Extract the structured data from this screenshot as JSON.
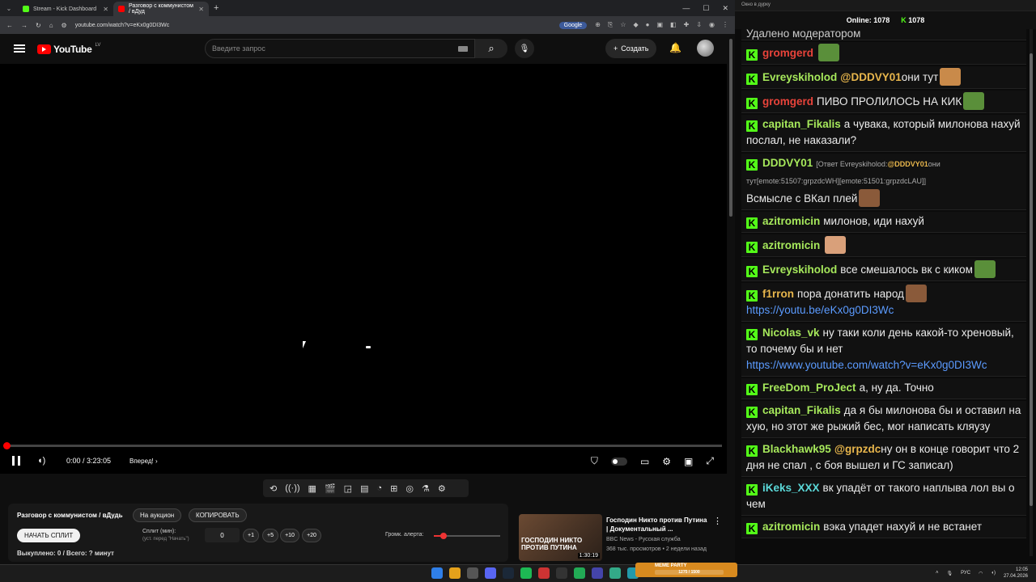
{
  "browser": {
    "tabs": [
      {
        "label": "Stream - Kick Dashboard",
        "color": "#53fc18"
      },
      {
        "label": "Разговор с коммунистом / вДуд",
        "color": "#ff0000"
      }
    ],
    "url": "youtube.com/watch?v=eKx0g0DI3Wc",
    "google_pill": "Google"
  },
  "youtube": {
    "logo": "YouTube",
    "region": "LV",
    "search_placeholder": "Введите запрос",
    "create_label": "Создать",
    "time": "0:00 / 3:23:05",
    "next_label": "Вперед!",
    "progress": 0
  },
  "panel": {
    "title": "Разговор с коммунистом / вДудь",
    "auction_btn": "На аукцион",
    "copy_btn": "КОПИРОВАТЬ",
    "start_btn": "НАЧАТЬ СПЛИТ",
    "split_label": "Сплит (мин):",
    "split_sub": "(уст. перед \"Начать\")",
    "split_value": "0",
    "increments": [
      "+1",
      "+5",
      "+10",
      "+20"
    ],
    "alert_label": "Громк. алерта:",
    "alert_volume": 0.15,
    "status": "Выкуплено: 0 / Всего: ? минут"
  },
  "recommended": {
    "thumb_text": "ГОСПОДИН НИКТО ПРОТИВ ПУТИНА",
    "duration": "1:30:19",
    "title": "Господин Никто против Путина | Документальный ...",
    "channel": "BBC News - Русская служба",
    "meta": "368 тыс. просмотров • 2 недели назад"
  },
  "chat_window": {
    "title": "Окно в дурку",
    "online_label": "Online:",
    "online_count": "1078",
    "kick_count": "1078"
  },
  "chat": [
    {
      "user": "gromgerd",
      "color": "#e8433a",
      "text": "",
      "emote": "#5a8f3a"
    },
    {
      "user": "Evreyskiholod",
      "color": "#a6e85b",
      "mention": "@DDDVY01",
      "text": "они тут",
      "emote": "#c98a4a"
    },
    {
      "user": "gromgerd",
      "color": "#e8433a",
      "text": "ПИВО ПРОЛИЛОСЬ НА КИК",
      "emote": "#5a8f3a"
    },
    {
      "user": "capitan_Fikalis",
      "color": "#a6e85b",
      "text": "а чувака, который милонова нахуй послал, не наказали?"
    },
    {
      "user": "DDDVY01",
      "color": "#a6e85b",
      "small": "[Ответ Evreyskiholod:",
      "mention": "@DDDVY01",
      "small2": "они тут[emote:51507:grpzdcWH][emote:51501:grpzdcLAU]]",
      "text": "Всмысле с ВКал плей",
      "emote": "#8a5a3a"
    },
    {
      "user": "azitromicin",
      "color": "#a6e85b",
      "text": "милонов, иди нахуй"
    },
    {
      "user": "azitromicin",
      "color": "#a6e85b",
      "text": "",
      "emote": "#d9a07a"
    },
    {
      "user": "Evreyskiholod",
      "color": "#a6e85b",
      "text": "все смешалось вк с киком",
      "emote": "#5a8f3a"
    },
    {
      "user": "f1rron",
      "color": "#e8b64c",
      "text": "пора донатить народ",
      "link": "https://youtu.be/eKx0g0DI3Wc",
      "emote": "#8a5a3a"
    },
    {
      "user": "Nicolas_vk",
      "color": "#a6e85b",
      "text": "ну таки коли день какой-то хреновый, то почему бы и нет",
      "link": "https://www.youtube.com/watch?v=eKx0g0DI3Wc"
    },
    {
      "user": "FreeDom_ProJect",
      "color": "#a6e85b",
      "text": "а, ну да. Точно"
    },
    {
      "user": "capitan_Fikalis",
      "color": "#a6e85b",
      "text": "да я бы милонова бы и оставил на хую, но этот же рыжий бес, мог написать кляузу"
    },
    {
      "user": "Blackhawk95",
      "color": "#a6e85b",
      "mention": "@grpzdc",
      "text": "ну он в конце говорит что 2 дня не спал , с боя вышел и ГС записал)"
    },
    {
      "user": "iKeks_XXX",
      "color": "#5bd9d9",
      "text": "вк упадёт от такого наплыва лол вы о чем"
    },
    {
      "user": "azitromicin",
      "color": "#a6e85b",
      "text": "вэка упадет нахуй и не встанет"
    }
  ],
  "chat_top_partial": "Удалено модератором",
  "taskbar": {
    "meme_title": "MEME PARTY",
    "meme_progress": "1275 / 1500",
    "lang": "РУС",
    "time": "12:05",
    "date": "27.04.2026"
  }
}
